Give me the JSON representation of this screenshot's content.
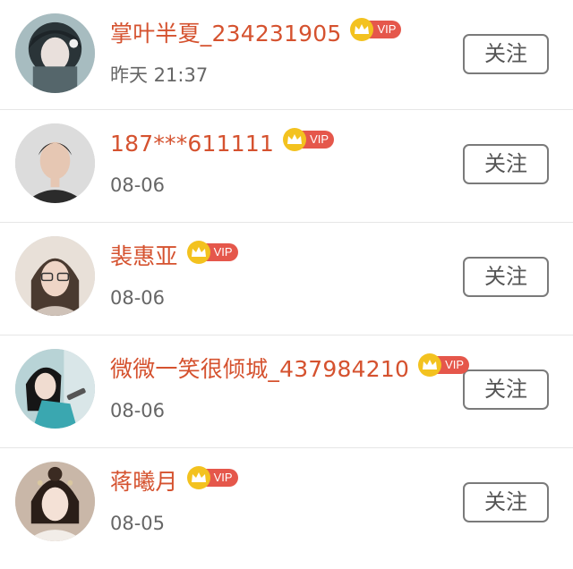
{
  "follow_label": "关注",
  "vip_label": "VIP",
  "users": [
    {
      "name": "掌叶半夏_234231905",
      "time": "昨天 21:37"
    },
    {
      "name": "187***611111",
      "time": "08-06"
    },
    {
      "name": "裴惠亚",
      "time": "08-06"
    },
    {
      "name": "微微一笑很倾城_437984210",
      "time": "08-06"
    },
    {
      "name": "蒋曦月",
      "time": "08-05"
    }
  ],
  "colors": {
    "name": "#d5522f",
    "vip_badge": "#e5574b",
    "crown": "#f3c21f",
    "time": "#666666",
    "button_border": "#7a7a7a"
  }
}
